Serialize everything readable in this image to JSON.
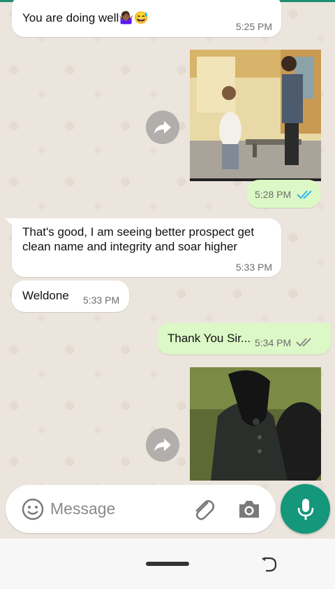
{
  "messages": [
    {
      "type": "text",
      "direction": "in",
      "text": "You are doing well🤷🏾‍♀️😅",
      "time": "5:25 PM"
    },
    {
      "type": "image",
      "direction": "out",
      "time": "5:28 PM",
      "status": "read"
    },
    {
      "type": "text",
      "direction": "in",
      "text": "That's good, I am seeing better prospect get clean name and integrity and soar higher",
      "time": "5:33 PM"
    },
    {
      "type": "text",
      "direction": "in",
      "text": "Weldone",
      "time": "5:33 PM"
    },
    {
      "type": "text",
      "direction": "out",
      "text": "Thank You Sir...",
      "time": "5:34 PM",
      "status": "delivered"
    },
    {
      "type": "image",
      "direction": "out"
    }
  ],
  "composer": {
    "placeholder": "Message",
    "icons": [
      "emoji-icon",
      "attach-icon",
      "camera-icon"
    ]
  },
  "mic_button": {
    "icon": "mic-icon"
  },
  "colors": {
    "incoming_bubble": "#ffffff",
    "outgoing_bubble": "#dcf8c6",
    "read_ticks": "#34b7f1",
    "delivered_ticks": "#8c8c8c",
    "accent": "#14977b",
    "chat_background": "#ece5dd"
  },
  "nav": {
    "icons": [
      "home-pill",
      "rotate-icon"
    ]
  }
}
